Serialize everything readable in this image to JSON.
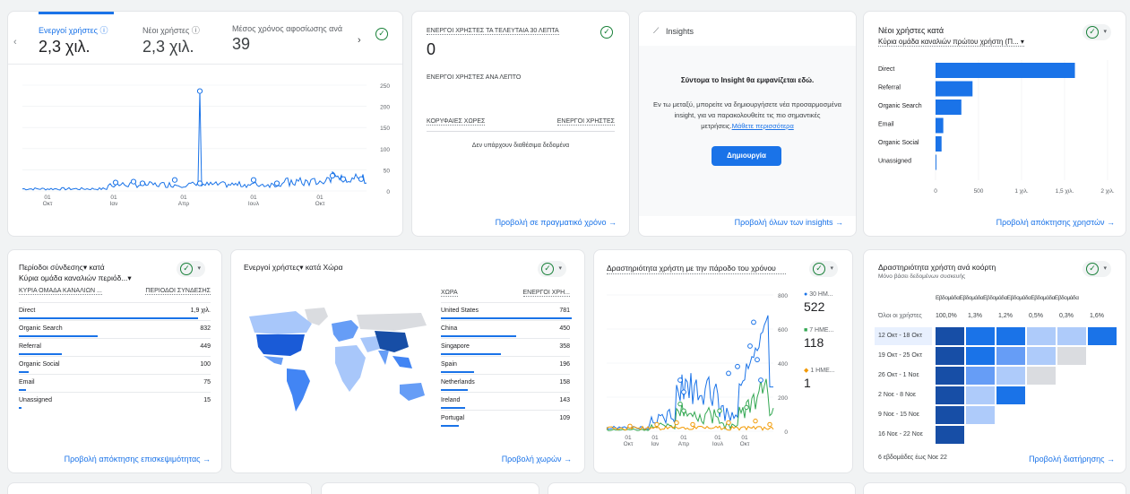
{
  "overview": {
    "metrics": [
      {
        "label": "Ενεργοί χρήστες",
        "value": "2,3 χιλ."
      },
      {
        "label": "Νέοι χρήστες",
        "value": "2,3 χιλ."
      },
      {
        "label": "Μέσος χρόνος αφοσίωσης ανά",
        "value": "39"
      }
    ],
    "y_ticks": [
      "250",
      "200",
      "150",
      "100",
      "50",
      "0"
    ],
    "x_ticks": [
      {
        "d": "01",
        "m": "Οκτ"
      },
      {
        "d": "01",
        "m": "Ιαν"
      },
      {
        "d": "01",
        "m": "Απρ"
      },
      {
        "d": "01",
        "m": "Ιουλ"
      },
      {
        "d": "01",
        "m": "Οκτ"
      }
    ]
  },
  "realtime": {
    "title": "ΕΝΕΡΓΟΙ ΧΡΗΣΤΕΣ ΤΑ ΤΕΛΕΥΤΑΙΑ 30 ΛΕΠΤΑ",
    "value": "0",
    "per_minute": "ΕΝΕΡΓΟΙ ΧΡΗΣΤΕΣ ΑΝΑ ΛΕΠΤΟ",
    "col_countries": "ΚΟΡΥΦΑΙΕΣ ΧΩΡΕΣ",
    "col_users": "ΕΝΕΡΓΟΙ ΧΡΗΣΤΕΣ",
    "empty": "Δεν υπάρχουν διαθέσιμα δεδομένα",
    "link": "Προβολή σε πραγματικό χρόνο →"
  },
  "insights": {
    "title": "Insights",
    "headline": "Σύντομα το Insight θα εμφανίζεται εδώ.",
    "body": "Εν τω μεταξύ, μπορείτε να δημιουργήσετε νέα προσαρμοσμένα insight, για να παρακολουθείτε τις πιο σημαντικές μετρήσεις.",
    "learn_more": "Μάθετε περισσότερα",
    "create": "Δημιουργία",
    "link": "Προβολή όλων των insights →"
  },
  "new_users_channel": {
    "title": "Νέοι χρήστες κατά",
    "subtitle": "Κύρια ομάδα καναλιών πρώτου χρήστη (Π... ▾",
    "x_ticks": [
      "0",
      "500",
      "1 χιλ.",
      "1,5 χιλ.",
      "2 χιλ."
    ],
    "link": "Προβολή απόκτησης χρηστών →"
  },
  "sessions_channel": {
    "title": "Περίοδοι σύνδεσης▾ κατά",
    "subtitle": "Κύρια ομάδα καναλιών περιόδ...▾",
    "col1": "ΚΥΡΙΑ ΟΜΑΔΑ ΚΑΝΑΛΙΩΝ ...",
    "col2": "ΠΕΡΙΟΔΟΙ ΣΥΝΔΕΣΗΣ",
    "rows": [
      {
        "name": "Direct",
        "value": "1,9 χιλ."
      },
      {
        "name": "Organic Search",
        "value": "832"
      },
      {
        "name": "Referral",
        "value": "449"
      },
      {
        "name": "Organic Social",
        "value": "100"
      },
      {
        "name": "Email",
        "value": "75"
      },
      {
        "name": "Unassigned",
        "value": "15"
      }
    ],
    "link": "Προβολή απόκτησης επισκεψιμότητας →"
  },
  "country": {
    "title": "Ενεργοί χρήστες▾ κατά Χώρα",
    "col1": "ΧΩΡΑ",
    "col2": "ΕΝΕΡΓΟΙ ΧΡΗ...",
    "rows": [
      {
        "name": "United States",
        "value": "781"
      },
      {
        "name": "China",
        "value": "450"
      },
      {
        "name": "Singapore",
        "value": "358"
      },
      {
        "name": "Spain",
        "value": "196"
      },
      {
        "name": "Netherlands",
        "value": "158"
      },
      {
        "name": "Ireland",
        "value": "143"
      },
      {
        "name": "Portugal",
        "value": "109"
      }
    ],
    "link": "Προβολή χωρών →"
  },
  "activity": {
    "title": "Δραστηριότητα χρήστη με την πάροδο του χρόνου",
    "y_ticks": [
      "800",
      "600",
      "400",
      "200",
      "0"
    ],
    "x_ticks": [
      {
        "d": "01",
        "m": "Οκτ"
      },
      {
        "d": "01",
        "m": "Ιαν"
      },
      {
        "d": "01",
        "m": "Απρ"
      },
      {
        "d": "01",
        "m": "Ιουλ"
      },
      {
        "d": "01",
        "m": "Οκτ"
      }
    ],
    "legend": [
      {
        "label": "30 ΗΜ...",
        "value": "522",
        "color": "#1a73e8"
      },
      {
        "label": "7 ΗΜΕ...",
        "value": "118",
        "color": "#34a853"
      },
      {
        "label": "1 ΗΜΕ...",
        "value": "1",
        "color": "#f29900"
      }
    ]
  },
  "cohort": {
    "title": "Δραστηριότητα χρήστη ανά κοόρτη",
    "subtitle": "Μόνο βάσει δεδομένων συσκευής",
    "header": "ΕβδομάδαΕβδομάδαΕβδομάδαΕβδομάδαΕβδομάδαΕβδομάδα",
    "all_label": "Όλοι οι χρήστες",
    "all_values": [
      "100,0%",
      "1,3%",
      "1,2%",
      "0,5%",
      "0,3%",
      "1,6%"
    ],
    "rows": [
      "12 Οκτ - 18 Οκτ",
      "19 Οκτ - 25 Οκτ",
      "26 Οκτ - 1 Νοε",
      "2 Νοε - 8 Νοε",
      "9 Νοε - 15 Νοε",
      "16 Νοε - 22 Νοε"
    ],
    "footer": "6 εβδομάδες έως Νοε 22",
    "link": "Προβολή διατήρησης →"
  }
}
